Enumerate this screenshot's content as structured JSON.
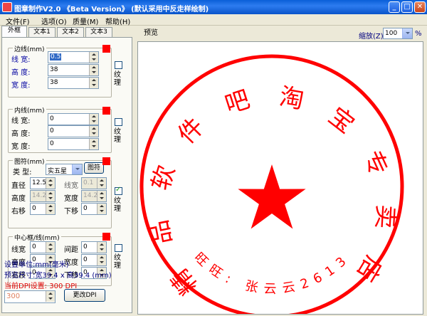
{
  "window": {
    "title": "图章制作V2.0 《Beta Version》 (默认采用中反走样绘制)"
  },
  "menu": [
    "文件(F)",
    "选项(O)",
    "质量(M)",
    "帮助(H)"
  ],
  "tabs": [
    "外框",
    "文本1",
    "文本2",
    "文本3"
  ],
  "border_group": {
    "title": "边线(mm)",
    "fields": [
      {
        "label": "线 宽:",
        "value": "0.5"
      },
      {
        "label": "高 度:",
        "value": "38"
      },
      {
        "label": "宽 度:",
        "value": "38"
      }
    ],
    "texture": "纹理"
  },
  "inner_group": {
    "title": "内线(mm)",
    "fields": [
      {
        "label": "线 宽:",
        "value": "0"
      },
      {
        "label": "高 度:",
        "value": "0"
      },
      {
        "label": "宽 度:",
        "value": "0"
      }
    ],
    "texture": "纹理"
  },
  "symbol_group": {
    "title": "图符(mm)",
    "type_label": "类 型:",
    "type_value": "实五星",
    "symbol_button": "图符",
    "diameter_label": "直径",
    "diameter": "12.5",
    "linew_label": "线宽",
    "linew": "0.1",
    "height_label": "高度",
    "height": "14.2",
    "width_label": "宽度",
    "width": "14.2",
    "right_label": "右移",
    "right": "0",
    "down_label": "下移",
    "down": "0",
    "texture": "纹理"
  },
  "center_group": {
    "title": "中心框/线(mm)",
    "linew_label": "线宽",
    "linew": "0",
    "gap_label": "间距",
    "gap": "0",
    "height_label": "高度",
    "height": "0",
    "width_label": "宽度",
    "width": "0",
    "right_label": "右移",
    "right": "0",
    "down_label": "下移",
    "down": "0",
    "texture": "纹理"
  },
  "units": "设置单位:mm(毫米)",
  "preview_size": "预览尺寸:宽39.4 x 高39.4 (mm)",
  "dpi_status": "当前DPI设置: 300 DPI",
  "dpi_value": "300",
  "dpi_button": "更改DPI",
  "preview": {
    "label": "预览",
    "zoom_label": "缩放(Z)",
    "zoom_value": "100",
    "zoom_unit": "%",
    "arc_text": "精品软件吧淘宝专卖店",
    "bottom_text": "旺旺: 张云云2613",
    "stamp_color": "#ff0000"
  }
}
